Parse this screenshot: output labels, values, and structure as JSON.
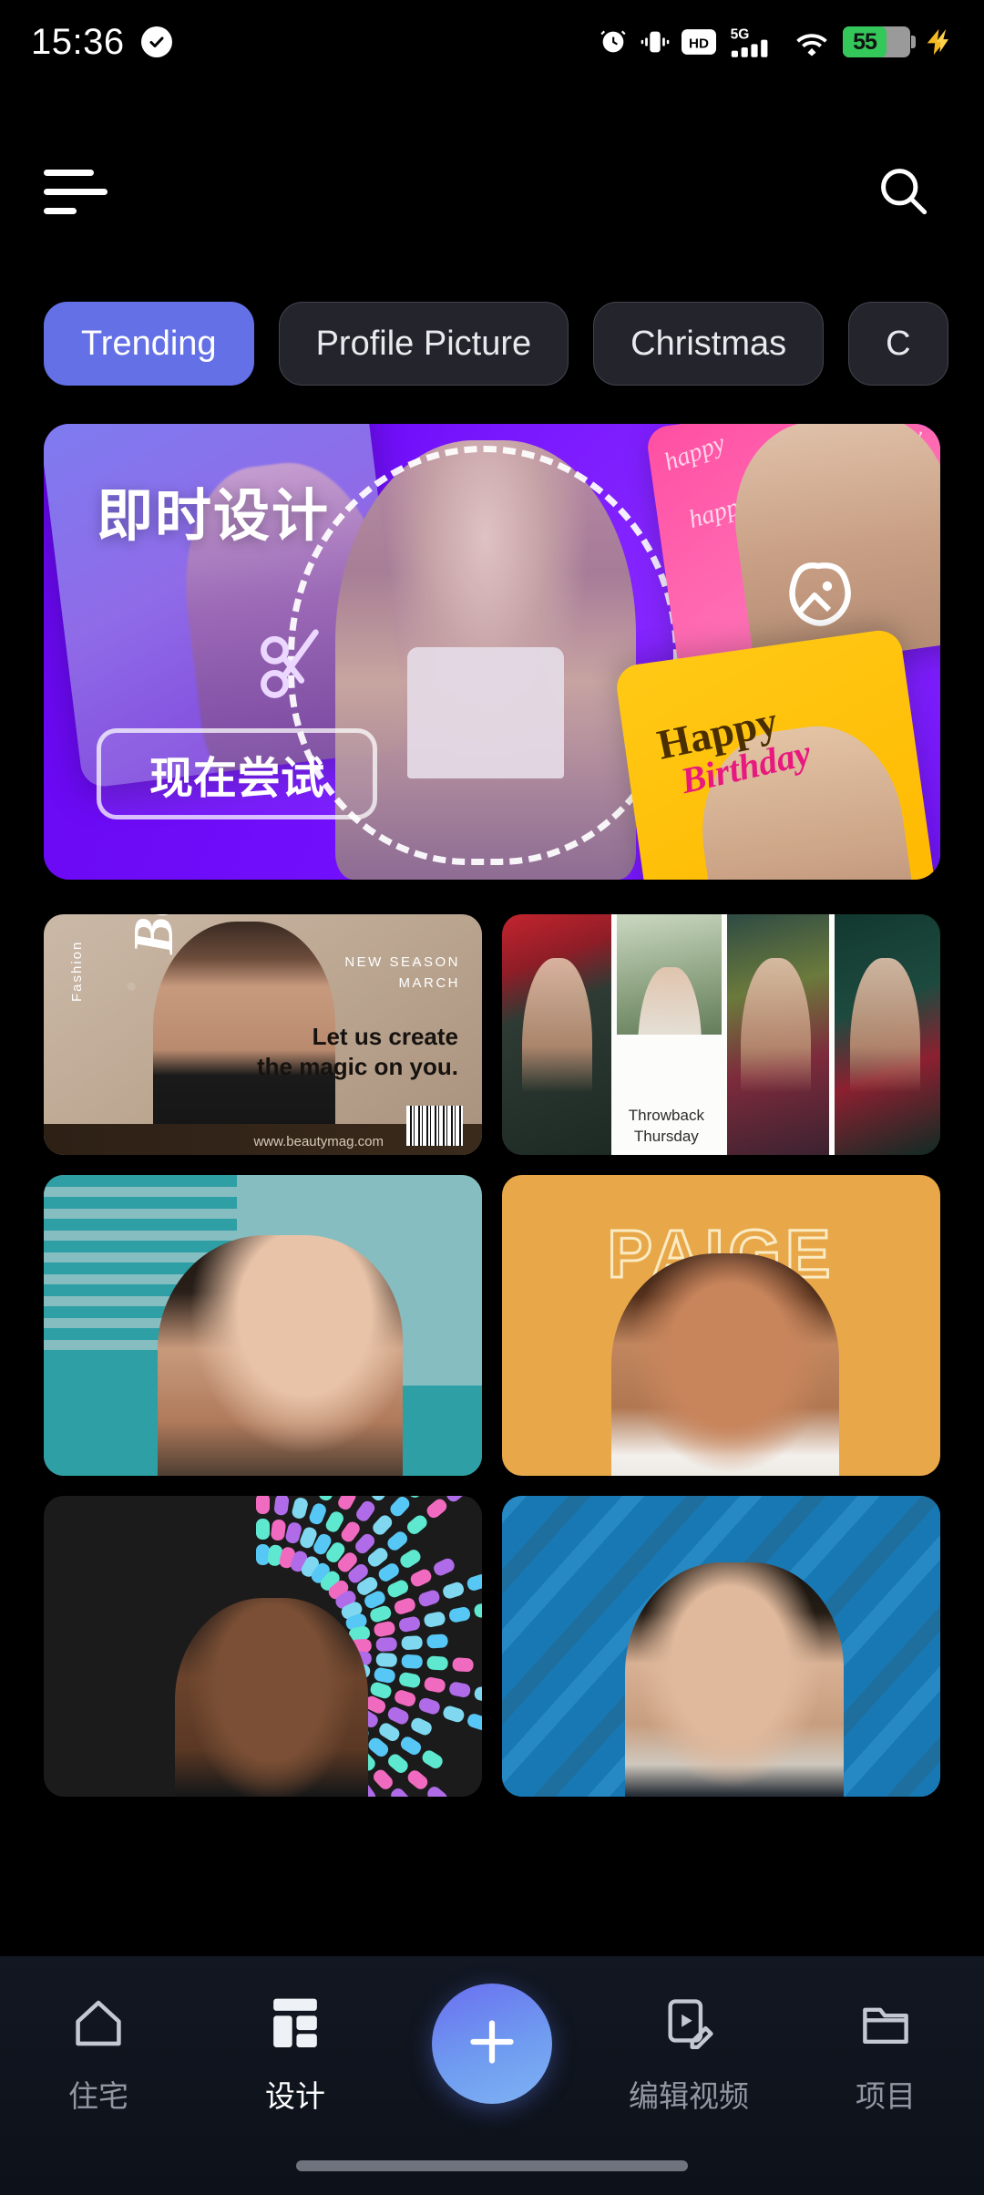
{
  "status_bar": {
    "time": "15:36",
    "dnd_icon": "check-circle-icon",
    "icons": [
      "alarm-icon",
      "vibrate-icon",
      "hd-icon",
      "5g-icon",
      "signal-bars-icon",
      "wifi-icon"
    ],
    "network_label": "5G",
    "hd_label": "HD",
    "battery_percent": "55",
    "battery_color": "#34C759",
    "charging_icon": "lightning-bolt-icon"
  },
  "header": {
    "menu_icon": "hamburger-menu-icon",
    "search_icon": "search-icon"
  },
  "chips": [
    {
      "label": "Trending",
      "active": true
    },
    {
      "label": "Profile Picture",
      "active": false
    },
    {
      "label": "Christmas",
      "active": false
    },
    {
      "label": "C",
      "active": false
    }
  ],
  "hero": {
    "title": "即时设计",
    "cta_label": "现在尝试",
    "background_color": "#6A0DF5",
    "pink_card_text": "happy",
    "yellow_card_line1": "Happy",
    "yellow_card_line2": "Birthday",
    "wand_icon": "magic-image-icon",
    "scissors_icon": "scissors-icon"
  },
  "grid": {
    "beauty": {
      "fashion_label": "Fashion",
      "title": "Beauty",
      "season_line1": "NEW SEASON",
      "season_line2": "MARCH",
      "tagline_line1": "Let us create",
      "tagline_line2": "the magic on you.",
      "url": "www.beautymag.com",
      "barcode_icon": "barcode-icon"
    },
    "throwback": {
      "line1": "Throwback",
      "line2": "Thursday"
    },
    "teal": {
      "background_color": "#86BDC0",
      "stripe_color": "#2D9FA5"
    },
    "paige": {
      "name": "PAIGE",
      "background_color": "#E8A849",
      "outline_color": "#FBEBC4"
    },
    "radial": {
      "background_color": "#1b1b1b",
      "bar_colors": [
        "#57C8F5",
        "#5EE8D0",
        "#F06BC0",
        "#B06BE8",
        "#7FD8F0"
      ]
    },
    "blue": {
      "background_color": "#1878B4"
    }
  },
  "bottom_nav": {
    "items": [
      {
        "label": "住宅",
        "icon": "home-icon",
        "active": false
      },
      {
        "label": "设计",
        "icon": "layout-grid-icon",
        "active": true
      },
      {
        "label": "编辑视频",
        "icon": "video-edit-icon",
        "active": false
      },
      {
        "label": "项目",
        "icon": "folder-icon",
        "active": false
      }
    ],
    "fab_icon": "plus-icon",
    "fab_color": "#6F9BF0"
  }
}
